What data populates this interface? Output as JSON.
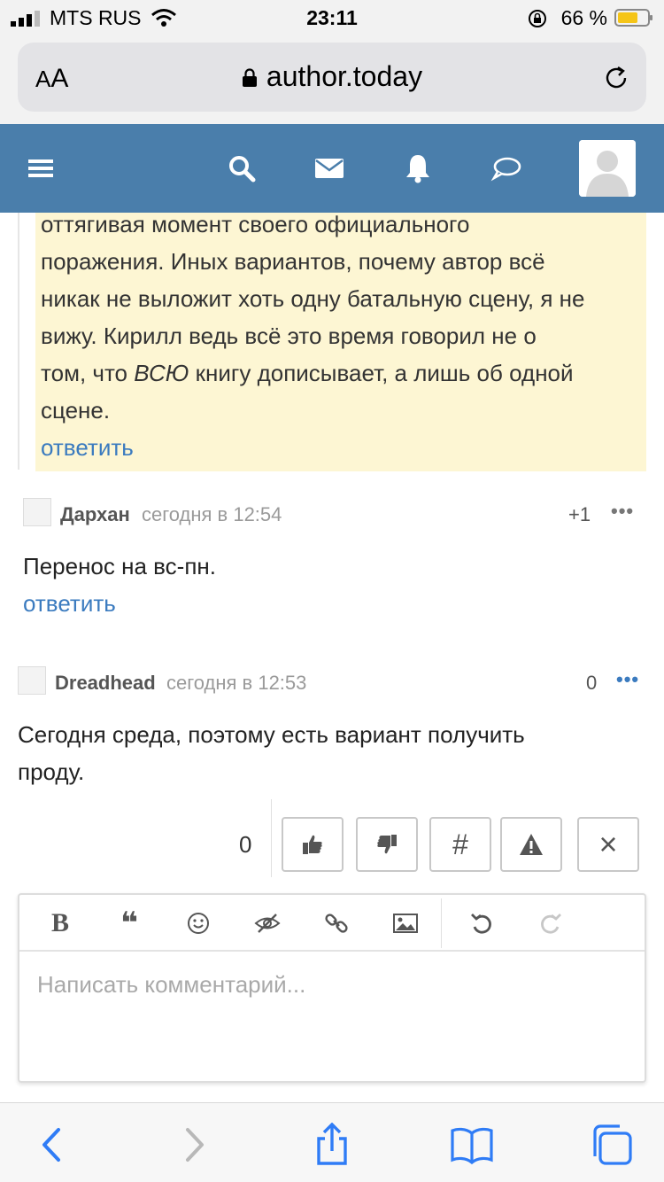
{
  "status_bar": {
    "carrier": "MTS RUS",
    "time": "23:11",
    "battery_percent": "66 %"
  },
  "browser": {
    "text_size_label_small": "A",
    "text_size_label_big": "A",
    "url": "author.today"
  },
  "colors": {
    "header": "#4a7eab",
    "link": "#3b7bbf",
    "highlight": "#fdf6d3",
    "ios_blue": "#2f7cf6"
  },
  "header_icons": [
    "menu-icon",
    "search-icon",
    "mail-icon",
    "bell-icon",
    "chat-icon",
    "user-avatar"
  ],
  "quoted_comment": {
    "lines": [
      "оттягивая момент своего официального",
      "поражения. Иных вариантов, почему автор всё",
      "никак не выложит хоть одну батальную сцену, я не",
      "вижу. Кирилл ведь всё это время говорил не о",
      "том, что ",
      "ВСЮ",
      " книгу дописывает, а лишь об одной",
      "сцене."
    ],
    "reply": "ответить"
  },
  "comments": [
    {
      "author": "Дархан",
      "time": "сегодня в 12:54",
      "score": "+1",
      "more": "•••",
      "text": "Перенос на вс-пн.",
      "reply": "ответить"
    },
    {
      "author": "Dreadhead",
      "time": "сегодня в 12:53",
      "score": "0",
      "more": "•••",
      "text_line1": "Сегодня среда, поэтому есть вариант получить",
      "text_line2": "проду."
    }
  ],
  "actions": {
    "count": "0",
    "hash": "#",
    "close": "×"
  },
  "editor": {
    "bold": "B",
    "quote": "❝",
    "placeholder": "Написать комментарий..."
  }
}
